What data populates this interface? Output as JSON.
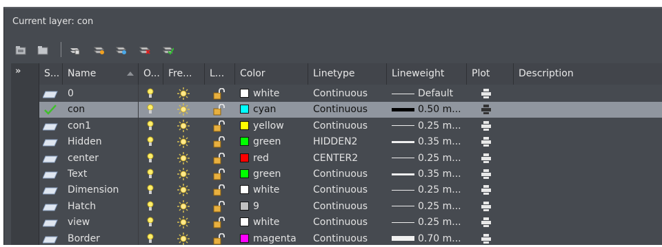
{
  "current_layer": {
    "label": "Current layer: con"
  },
  "toolbar": {
    "icons": [
      "new-group-filter-icon",
      "new-property-filter-icon",
      "layer-states-manager-icon",
      "new-layer-icon",
      "new-layer-vp-frozen-icon",
      "delete-layer-icon",
      "set-current-icon"
    ]
  },
  "headers": {
    "status": "S...",
    "name": "Name",
    "on": "O...",
    "freeze": "Fre...",
    "lock": "L...",
    "color": "Color",
    "linetype": "Linetype",
    "lineweight": "Lineweight",
    "plot": "Plot",
    "description": "Description"
  },
  "expand_label": "»",
  "layers": [
    {
      "name": "0",
      "color_name": "white",
      "color_hex": "#ffffff",
      "linetype": "Continuous",
      "lineweight": "Default",
      "lw_thickness": 1,
      "current": false
    },
    {
      "name": "con",
      "color_name": "cyan",
      "color_hex": "#00ffff",
      "linetype": "Continuous",
      "lineweight": "0.50  m...",
      "lw_thickness": 5,
      "current": true
    },
    {
      "name": "con1",
      "color_name": "yellow",
      "color_hex": "#ffff00",
      "linetype": "Continuous",
      "lineweight": "0.25  m...",
      "lw_thickness": 1,
      "current": false
    },
    {
      "name": "Hidden",
      "color_name": "green",
      "color_hex": "#00ff00",
      "linetype": "HIDDEN2",
      "lineweight": "0.35  m...",
      "lw_thickness": 3,
      "current": false
    },
    {
      "name": "center",
      "color_name": "red",
      "color_hex": "#ff0000",
      "linetype": "CENTER2",
      "lineweight": "0.25  m...",
      "lw_thickness": 1,
      "current": false
    },
    {
      "name": "Text",
      "color_name": "green",
      "color_hex": "#00ff00",
      "linetype": "Continuous",
      "lineweight": "0.35  m...",
      "lw_thickness": 3,
      "current": false
    },
    {
      "name": "Dimension",
      "color_name": "white",
      "color_hex": "#ffffff",
      "linetype": "Continuous",
      "lineweight": "0.25  m...",
      "lw_thickness": 1,
      "current": false
    },
    {
      "name": "Hatch",
      "color_name": "9",
      "color_hex": "#c0c0c0",
      "linetype": "Continuous",
      "lineweight": "0.25  m...",
      "lw_thickness": 1,
      "current": false
    },
    {
      "name": "view",
      "color_name": "white",
      "color_hex": "#ffffff",
      "linetype": "Continuous",
      "lineweight": "0.25  m...",
      "lw_thickness": 1,
      "current": false
    },
    {
      "name": "Border",
      "color_name": "magenta",
      "color_hex": "#ff00ff",
      "linetype": "Continuous",
      "lineweight": "0.70  m...",
      "lw_thickness": 7,
      "current": false
    }
  ],
  "colors": {
    "panel_bg": "#464a50",
    "selected_row": "#90969f",
    "current_check": "#3fbf2a"
  }
}
